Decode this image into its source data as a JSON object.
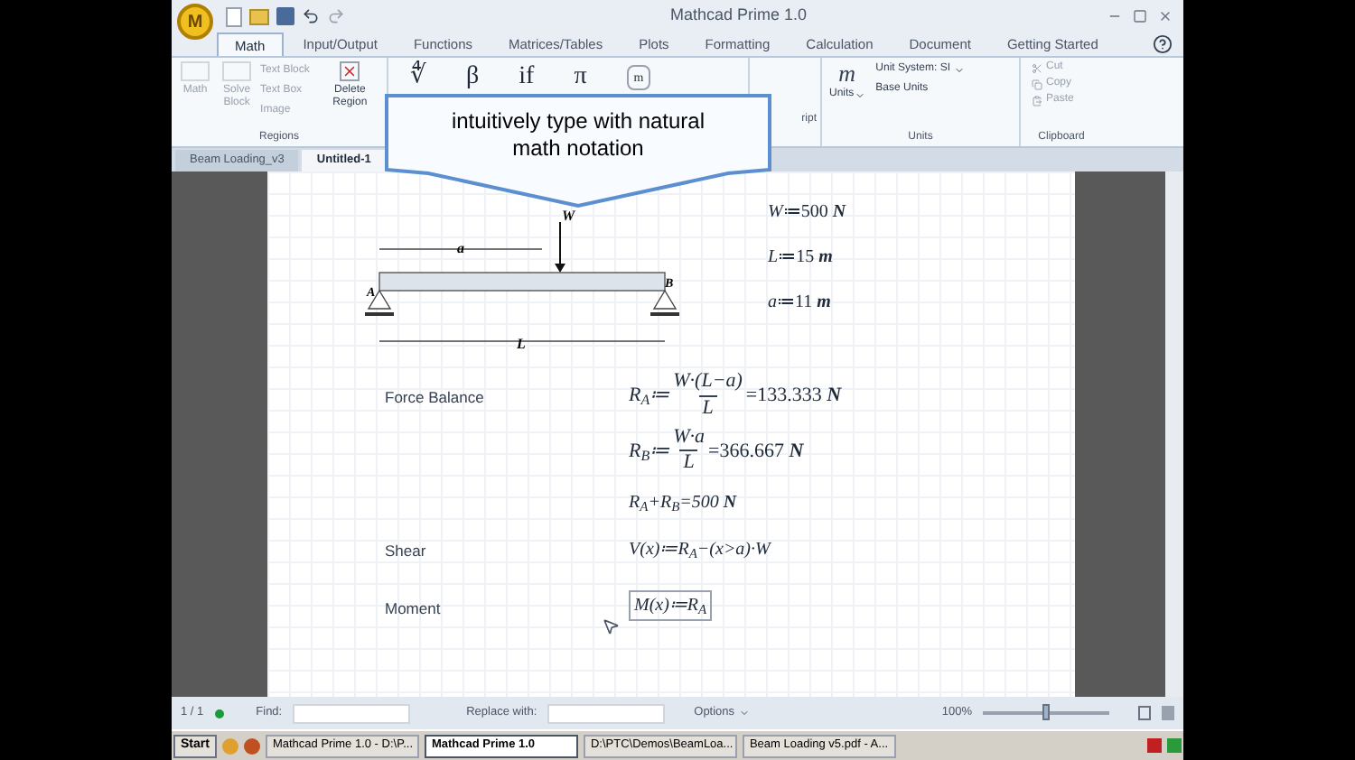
{
  "window": {
    "title": "Mathcad Prime 1.0",
    "logo": "M"
  },
  "ribbon_tabs": [
    {
      "label": "Math",
      "selected": true
    },
    {
      "label": "Input/Output",
      "selected": false
    },
    {
      "label": "Functions",
      "selected": false
    },
    {
      "label": "Matrices/Tables",
      "selected": false
    },
    {
      "label": "Plots",
      "selected": false
    },
    {
      "label": "Formatting",
      "selected": false
    },
    {
      "label": "Calculation",
      "selected": false
    },
    {
      "label": "Document",
      "selected": false
    },
    {
      "label": "Getting Started",
      "selected": false
    }
  ],
  "regions_group": {
    "label": "Regions",
    "big_buttons": [
      {
        "label": "Math",
        "disabled": true
      },
      {
        "label": "Solve Block",
        "disabled": true
      }
    ],
    "small_buttons": [
      {
        "label": "Text Block",
        "disabled": true
      },
      {
        "label": "Text Box",
        "disabled": true
      },
      {
        "label": "Image",
        "disabled": true
      }
    ],
    "delete": {
      "label": "Delete Region",
      "disabled": false
    }
  },
  "operators": [
    "∜",
    "β",
    "if",
    "π"
  ],
  "label_button": "m",
  "subscript_label": "ript",
  "units_group": {
    "label": "Units",
    "symbol": "m",
    "units_button": "Units",
    "unit_system": "Unit System: SI",
    "base_units": "Base Units"
  },
  "clipboard_group": {
    "label": "Clipboard",
    "buttons": [
      {
        "label": "Cut",
        "disabled": true
      },
      {
        "label": "Copy",
        "disabled": true
      },
      {
        "label": "Paste",
        "disabled": true
      }
    ]
  },
  "doc_tabs": [
    {
      "label": "Beam Loading_v3",
      "selected": false
    },
    {
      "label": "Untitled-1",
      "selected": true
    }
  ],
  "callout": "intuitively type with natural math notation",
  "beam_labels": {
    "load": "W",
    "span_a": "a",
    "support_a": "A",
    "support_b": "B",
    "length": "L"
  },
  "definitions": [
    {
      "name": "W",
      "op": "≔",
      "value": "500",
      "unit": "N"
    },
    {
      "name": "L",
      "op": "≔",
      "value": "15",
      "unit": "m"
    },
    {
      "name": "a",
      "op": "≔",
      "value": "11",
      "unit": "m"
    }
  ],
  "section_labels": [
    "Force Balance",
    "Shear",
    "Moment"
  ],
  "fractions": [
    {
      "lhs": "R",
      "sub": "A",
      "op": "≔",
      "num": "W·(L−a)",
      "den": "L",
      "eq": "=",
      "result": "133.333",
      "unit": "N"
    },
    {
      "lhs": "R",
      "sub": "B",
      "op": "≔",
      "num": "W·a",
      "den": "L",
      "eq": "=",
      "result": "366.667",
      "unit": "N"
    }
  ],
  "sum_check": {
    "text": "R$_{A}$+R$_{B}$=500",
    "unit": "N"
  },
  "shear": "V(x)≔R$_{A}$−(x>a)·W",
  "moment": {
    "text": "M(x)≔R$_{A}$",
    "editing": true
  },
  "status_bar": {
    "page": "1 / 1",
    "find": "Find:",
    "replace": "Replace with:",
    "options": "Options",
    "zoom": "100%",
    "zoom_slider": {
      "level": 0.5
    }
  },
  "taskbar": {
    "start": "Start",
    "tasks": [
      {
        "label": "Mathcad Prime 1.0 - D:\\P...",
        "selected": false
      },
      {
        "label": "Mathcad Prime 1.0",
        "selected": true
      },
      {
        "label": "D:\\PTC\\Demos\\BeamLoa...",
        "selected": false
      },
      {
        "label": "Beam Loading v5.pdf - A...",
        "selected": false
      }
    ]
  }
}
